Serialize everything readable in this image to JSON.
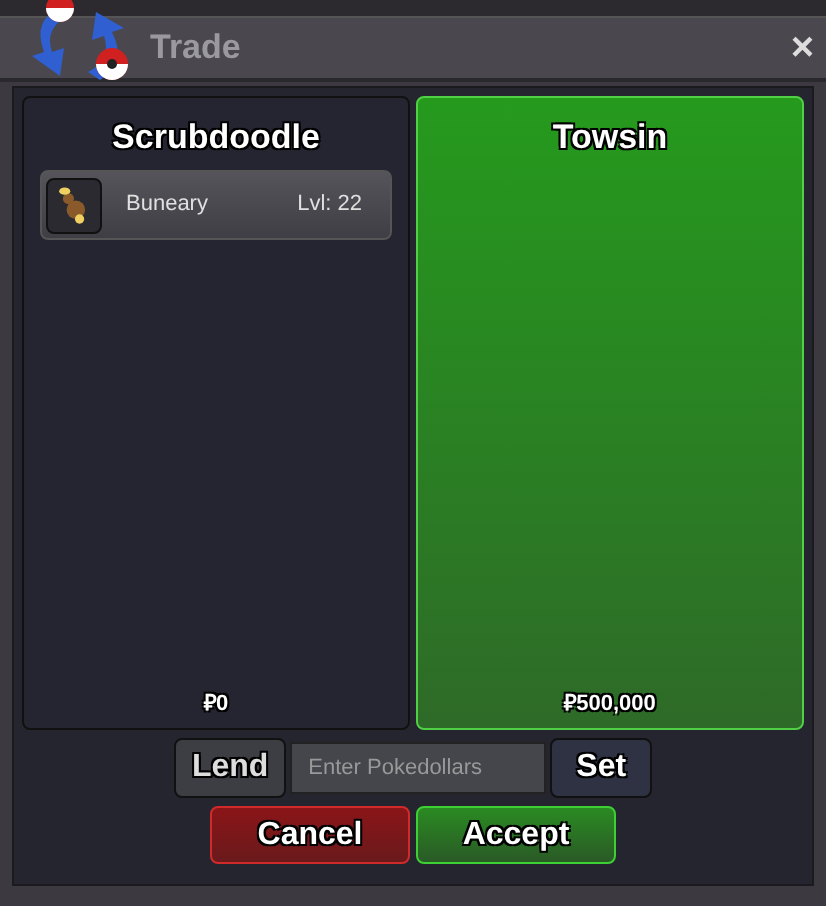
{
  "window": {
    "title": "Trade",
    "close": "×"
  },
  "traders": [
    {
      "name": "Scrubdoodle",
      "accepted": false,
      "items": [
        {
          "name": "Buneary",
          "level": "Lvl: 22"
        }
      ],
      "money": "₽0"
    },
    {
      "name": "Towsin",
      "accepted": true,
      "money": "₽500,000"
    }
  ],
  "money_row": {
    "lend": "Lend",
    "placeholder": "Enter Pokedollars",
    "set": "Set"
  },
  "buttons": [
    {
      "label": "Cancel",
      "kind": "cancel"
    },
    {
      "label": "Accept",
      "kind": "accept"
    }
  ]
}
